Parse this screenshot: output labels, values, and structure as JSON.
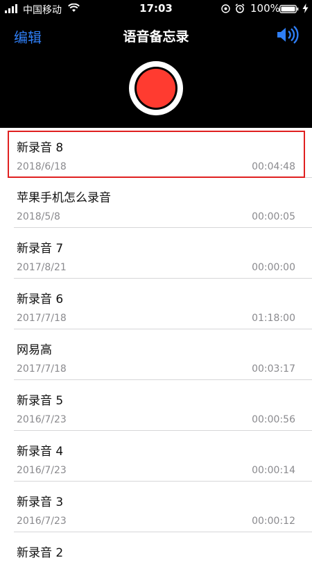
{
  "status_bar": {
    "carrier": "中国移动",
    "time": "17:03",
    "battery": "100%"
  },
  "nav": {
    "edit_label": "编辑",
    "title": "语音备忘录"
  },
  "colors": {
    "accent": "#2f7ff7",
    "record": "#ff3b30",
    "highlight": "#e02020"
  },
  "recordings": [
    {
      "title": "新录音 8",
      "date": "2018/6/18",
      "duration": "00:04:48"
    },
    {
      "title": "苹果手机怎么录音",
      "date": "2018/5/8",
      "duration": "00:00:05"
    },
    {
      "title": "新录音 7",
      "date": "2017/8/21",
      "duration": "00:00:00"
    },
    {
      "title": "新录音 6",
      "date": "2017/7/18",
      "duration": "01:18:00"
    },
    {
      "title": "网易高",
      "date": "2017/7/18",
      "duration": "00:03:17"
    },
    {
      "title": "新录音 5",
      "date": "2016/7/23",
      "duration": "00:00:56"
    },
    {
      "title": "新录音 4",
      "date": "2016/7/23",
      "duration": "00:00:14"
    },
    {
      "title": "新录音 3",
      "date": "2016/7/23",
      "duration": "00:00:12"
    },
    {
      "title": "新录音 2",
      "date": "",
      "duration": ""
    }
  ]
}
